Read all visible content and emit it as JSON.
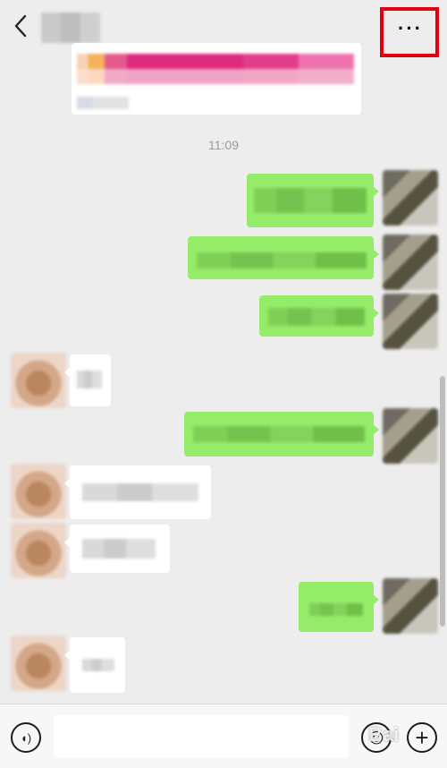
{
  "header": {
    "back_icon": "chevron-left-icon",
    "contact_name": "",
    "more_icon": "more-dots-icon",
    "more_label": "···",
    "highlight_color": "#e10010"
  },
  "timestamp": "11:09",
  "colors": {
    "outgoing_bubble": "#95ec69",
    "incoming_bubble": "#ffffff",
    "background": "#ededed"
  },
  "input_bar": {
    "voice_icon": "voice-icon",
    "voice_label": "◖)",
    "emoji_icon": "emoji-icon",
    "emoji_label": "☺",
    "plus_icon": "plus-icon",
    "plus_label": "+",
    "input_value": ""
  },
  "watermark": "Bai"
}
